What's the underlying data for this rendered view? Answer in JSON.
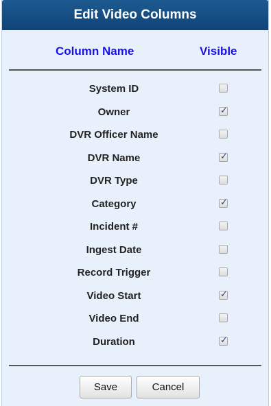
{
  "dialog": {
    "title": "Edit Video Columns",
    "header": {
      "column_name": "Column Name",
      "visible": "Visible"
    },
    "rows": [
      {
        "label": "System ID",
        "checked": false
      },
      {
        "label": "Owner",
        "checked": true
      },
      {
        "label": "DVR Officer Name",
        "checked": false
      },
      {
        "label": "DVR Name",
        "checked": true
      },
      {
        "label": "DVR Type",
        "checked": false
      },
      {
        "label": "Category",
        "checked": true
      },
      {
        "label": "Incident #",
        "checked": false
      },
      {
        "label": "Ingest Date",
        "checked": false
      },
      {
        "label": "Record Trigger",
        "checked": false
      },
      {
        "label": "Video Start",
        "checked": true
      },
      {
        "label": "Video End",
        "checked": false
      },
      {
        "label": "Duration",
        "checked": true
      }
    ],
    "buttons": {
      "save": "Save",
      "cancel": "Cancel"
    },
    "colors": {
      "title_bg": "#1d5a91",
      "panel_bg": "#e8f1fb",
      "header_text": "#1a10e8"
    }
  }
}
